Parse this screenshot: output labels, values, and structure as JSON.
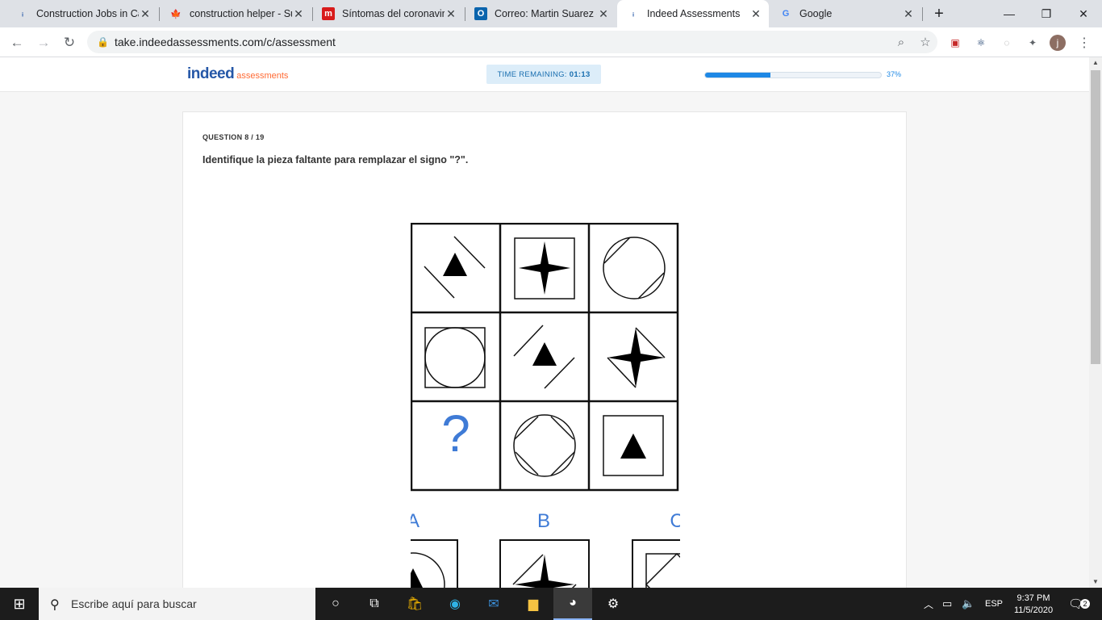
{
  "browser": {
    "tabs": [
      {
        "title": "Construction Jobs in Ca",
        "icon": "indeed-icon"
      },
      {
        "title": "construction helper - Su",
        "icon": "maple-leaf-icon"
      },
      {
        "title": "Síntomas del coronaviru",
        "icon": "m-logo-icon"
      },
      {
        "title": "Correo: Martin Suarez -",
        "icon": "outlook-icon"
      },
      {
        "title": "Indeed Assessments",
        "icon": "indeed-icon"
      },
      {
        "title": "Google",
        "icon": "google-icon"
      }
    ],
    "active_tab": 4,
    "url": "take.indeedassessments.com/c/assessment",
    "profile_initial": "j"
  },
  "header": {
    "logo_main": "indeed",
    "logo_sub": "assessments",
    "timer_label": "TIME REMAINING:",
    "timer_value": "01:13",
    "progress_percent": 37,
    "progress_label": "37%"
  },
  "question": {
    "number_label": "QUESTION 8 / 19",
    "text": "Identifique la pieza faltante para remplazar el signo \"?\".",
    "missing_mark": "?",
    "grid": [
      [
        "triangle-between-diagonal-lines",
        "star-in-square",
        "circle-with-diagonal-chords"
      ],
      [
        "circle-in-square",
        "triangle-between-diagonal-lines",
        "star-with-diagonal-lines"
      ],
      [
        "missing",
        "circle-with-diagonal-chords",
        "triangle-in-square"
      ]
    ],
    "options": [
      {
        "letter": "A",
        "figure": "triangle-in-circle"
      },
      {
        "letter": "B",
        "figure": "star-with-lines"
      },
      {
        "letter": "C",
        "figure": "diamond-in-square"
      }
    ]
  },
  "taskbar": {
    "search_placeholder": "Escribe aquí para buscar",
    "language": "ESP",
    "time": "9:37 PM",
    "date": "11/5/2020",
    "notification_count": "2"
  },
  "colors": {
    "accent": "#1e88e5",
    "indeed_blue": "#2557a7",
    "question_mark": "#3f7bd6"
  }
}
